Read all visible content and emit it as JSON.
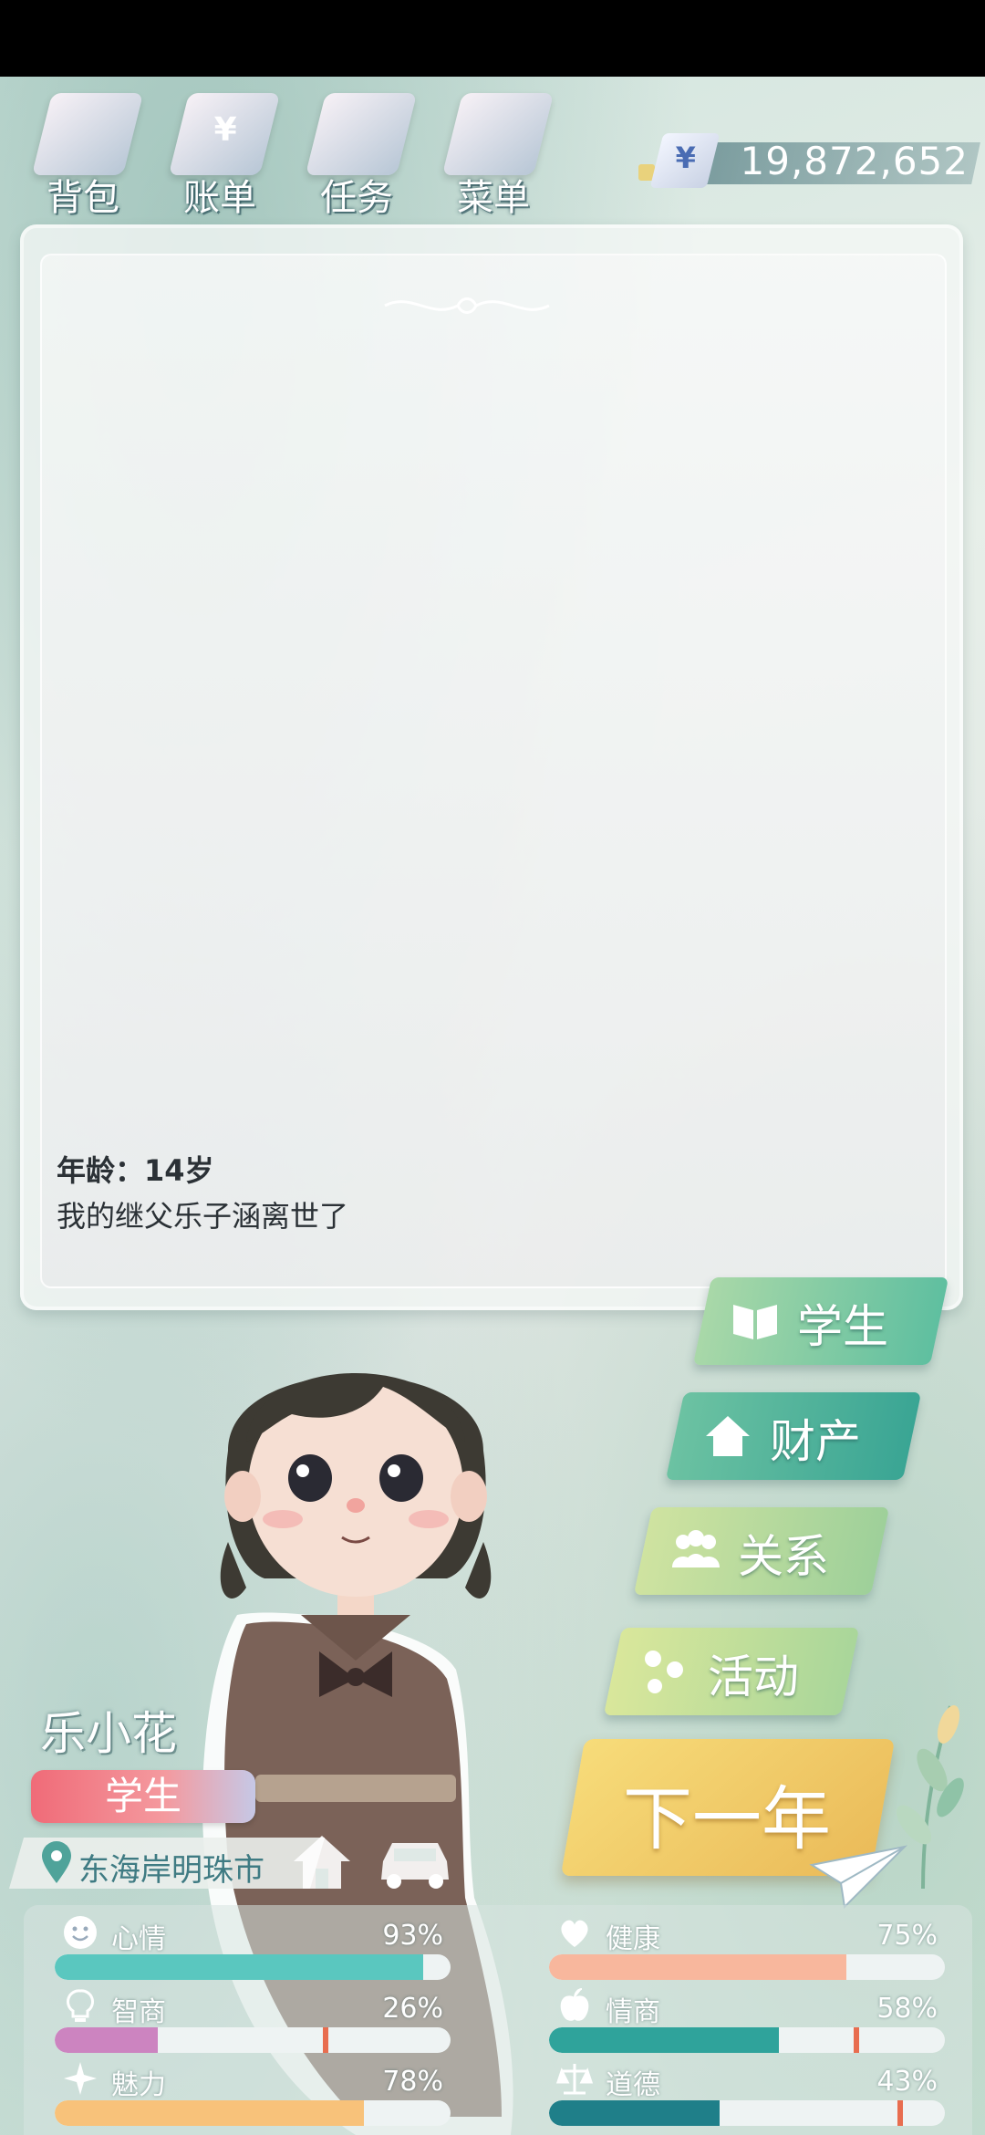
{
  "top_menu": {
    "items": [
      {
        "label": "背包",
        "icon": "backpack-icon"
      },
      {
        "label": "账单",
        "icon": "bill-icon",
        "glyph": "¥"
      },
      {
        "label": "任务",
        "icon": "task-icon"
      },
      {
        "label": "菜单",
        "icon": "menu-icon"
      }
    ],
    "money": {
      "currency": "¥",
      "value": "19,872,652"
    }
  },
  "story": {
    "age_line": "年龄：14岁",
    "event_line": "我的继父乐子涵离世了"
  },
  "actions": {
    "student": "学生",
    "property": "财产",
    "relationship": "关系",
    "activity": "活动",
    "next_year": "下一年"
  },
  "profile": {
    "name": "乐小花",
    "job": "学生",
    "location": "东海岸明珠市"
  },
  "stats": [
    {
      "label": "心情",
      "value": "93%",
      "fraction": 0.93,
      "color": "#5ac7bf",
      "icon": "smile-icon"
    },
    {
      "label": "健康",
      "value": "75%",
      "fraction": 0.75,
      "color": "#f8b79d",
      "icon": "heart-icon"
    },
    {
      "label": "智商",
      "value": "26%",
      "fraction": 0.26,
      "color": "#cc84c0",
      "icon": "lightbulb-icon"
    },
    {
      "label": "情商",
      "value": "58%",
      "fraction": 0.58,
      "color": "#2fa39b",
      "icon": "apple-icon"
    },
    {
      "label": "魅力",
      "value": "78%",
      "fraction": 0.78,
      "color": "#f8c27a",
      "icon": "sparkle-icon"
    },
    {
      "label": "道德",
      "value": "43%",
      "fraction": 0.43,
      "color": "#1f7f89",
      "icon": "scales-icon"
    }
  ],
  "colors": {
    "accent": "#3aa594",
    "job_badge": "#f06b78",
    "next_year": "#eaba58"
  }
}
